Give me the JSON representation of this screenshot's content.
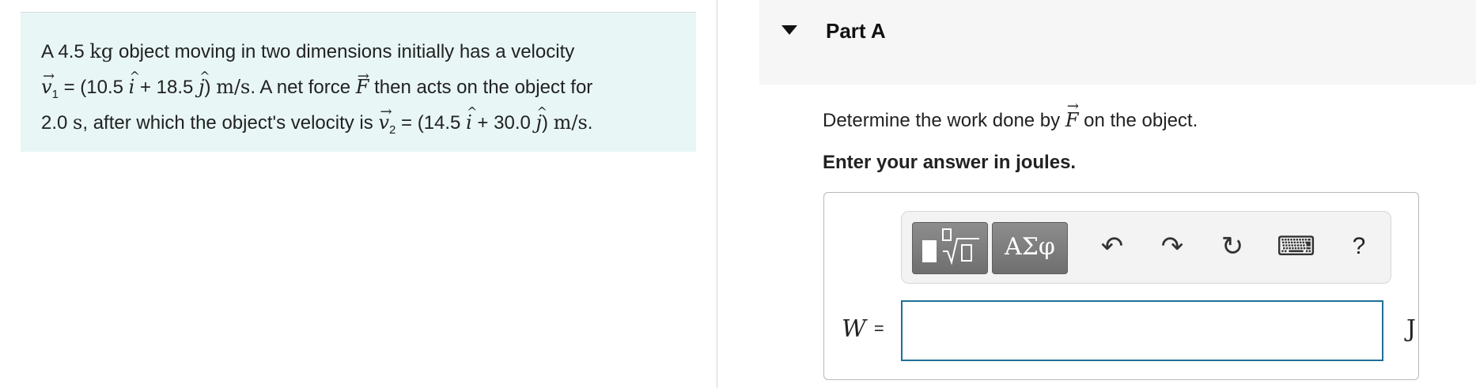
{
  "problem": {
    "line1": {
      "prefix": "A 4.5 ",
      "mass_unit": "kg",
      "suffix": " object moving in two dimensions initially has a velocity"
    },
    "line2": {
      "v1_symbol": "v",
      "v1_sub": "1",
      "eq_open": " = (10.5 ",
      "i_hat": "i",
      "plus": " + 18.5 ",
      "j_hat": "j",
      "close": ") ",
      "unit": "m/s",
      "text_after": ". A net force ",
      "force_symbol": "F",
      "tail": " then acts on the object for"
    },
    "line3": {
      "time": "2.0 ",
      "time_unit": "s",
      "text": ", after which the object's velocity is ",
      "v2_symbol": "v",
      "v2_sub": "2",
      "eq_open": " = (14.5 ",
      "i_hat": "i",
      "plus": " + 30.0 ",
      "j_hat": "j",
      "close": ") ",
      "unit": "m/s",
      "end": "."
    }
  },
  "part": {
    "title": "Part A"
  },
  "question": {
    "prefix": "Determine the work done by ",
    "force_symbol": "F",
    "suffix": " on the object."
  },
  "instruction": "Enter your answer in joules.",
  "toolbar": {
    "symbols_label": "ΑΣφ",
    "undo_glyph": "↶",
    "redo_glyph": "↷",
    "reset_glyph": "↻",
    "keyboard_glyph": "⌨",
    "help_label": "?"
  },
  "answer": {
    "variable": "W",
    "equals": "=",
    "value": "",
    "unit": "J"
  },
  "icons": [
    "caret-down-icon",
    "templates-icon",
    "undo-icon",
    "redo-icon",
    "reset-icon",
    "keyboard-icon",
    "help-icon"
  ],
  "colors": {
    "problem_bg": "#e8f6f6",
    "input_border": "#1d6f9a",
    "toolbar_button": "#7a7a7a"
  }
}
